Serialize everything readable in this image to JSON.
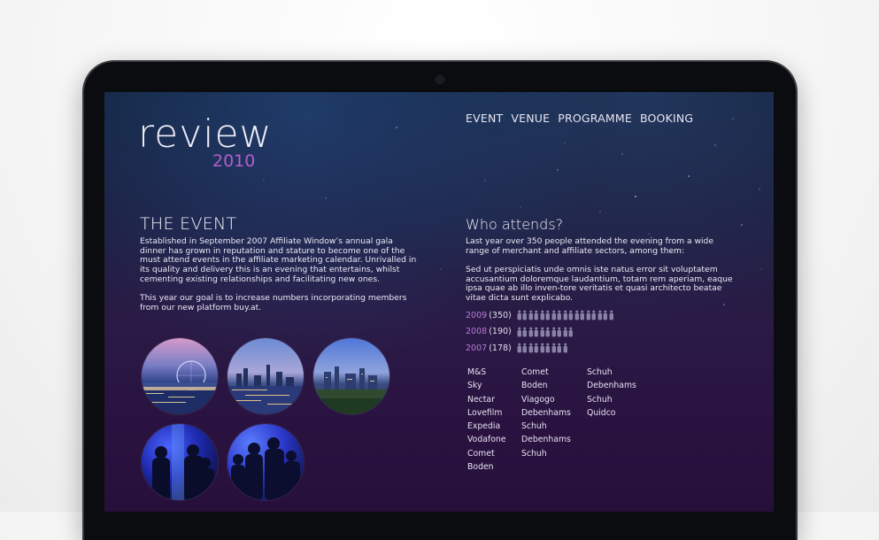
{
  "logo": {
    "word": "review",
    "year": "2010"
  },
  "nav": [
    "EVENT",
    "VENUE",
    "PROGRAMME",
    "BOOKING"
  ],
  "event": {
    "heading": "THE EVENT",
    "paragraph1": "Established in September 2007 Affiliate Window’s annual gala dinner has grown in reputation and stature to become one of the must attend events in the affiliate marketing calendar.  Unrivalled in its quality and delivery this is an evening that entertains, whilst cementing existing relationships and facilitating new ones.",
    "paragraph2": "This year our goal is to increase numbers incorporating members from our new platform buy.at."
  },
  "attends": {
    "heading": "Who attends?",
    "paragraph1": "Last year over 350 people attended the evening from a wide range of merchant and affiliate sectors, among them:",
    "paragraph2": "Sed ut perspiciatis unde omnis iste natus error sit voluptatem accusantium doloremque laudantium, totam rem aperiam, eaque ipsa quae ab illo inven-tore veritatis et quasi architecto beatae vitae dicta sunt explicabo."
  },
  "stats": [
    {
      "year": "2009",
      "count": "(350)",
      "icons": 17
    },
    {
      "year": "2008",
      "count": "(190)",
      "icons": 10
    },
    {
      "year": "2007",
      "count": "(178)",
      "icons": 9
    }
  ],
  "sponsors": [
    [
      "M&S",
      "Sky",
      "Nectar",
      "Lovefilm",
      "Expedia",
      "Vodafone",
      "Comet",
      "Boden"
    ],
    [
      "Comet",
      "Boden",
      "Viagogo",
      "Debenhams",
      "Schuh",
      "Debenhams",
      "Schuh"
    ],
    [
      "Schuh",
      "Debenhams",
      "Schuh",
      "Quidco"
    ]
  ],
  "photos": [
    "london-eye-photo",
    "london-skyline-photo",
    "london-city-photo",
    "party-photo-1",
    "party-photo-2"
  ],
  "colors": {
    "accent": "#b25fd0",
    "text": "#ece9f5",
    "bg_top": "#13233d",
    "bg_bottom": "#26103a"
  }
}
